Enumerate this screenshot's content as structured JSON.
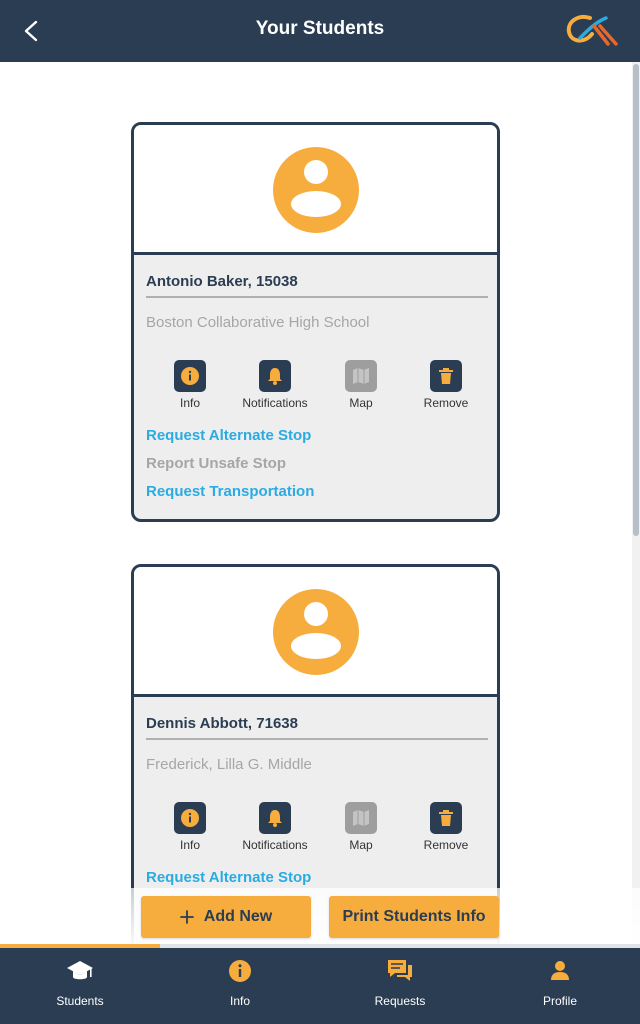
{
  "header": {
    "title": "Your Students"
  },
  "colors": {
    "navy": "#2a3d52",
    "accent": "#f7ad3e",
    "link": "#2aabe2",
    "muted": "#a6a6a6"
  },
  "students": [
    {
      "name": "Antonio Baker, 15038",
      "school": "Boston Collaborative High School",
      "actions": [
        "Info",
        "Notifications",
        "Map",
        "Remove"
      ],
      "map_enabled": false,
      "links": {
        "alternate": "Request Alternate Stop",
        "unsafe": "Report Unsafe Stop",
        "transport": "Request Transportation"
      }
    },
    {
      "name": "Dennis Abbott, 71638",
      "school": "Frederick, Lilla G. Middle",
      "actions": [
        "Info",
        "Notifications",
        "Map",
        "Remove"
      ],
      "map_enabled": false,
      "links": {
        "alternate": "Request Alternate Stop"
      }
    }
  ],
  "buttons": {
    "add_new": "Add New",
    "print": "Print Students Info"
  },
  "loading_progress": 0.25,
  "nav": [
    {
      "label": "Students",
      "icon": "graduation-cap-icon"
    },
    {
      "label": "Info",
      "icon": "info-icon"
    },
    {
      "label": "Requests",
      "icon": "chat-bubbles-icon"
    },
    {
      "label": "Profile",
      "icon": "person-icon"
    }
  ]
}
